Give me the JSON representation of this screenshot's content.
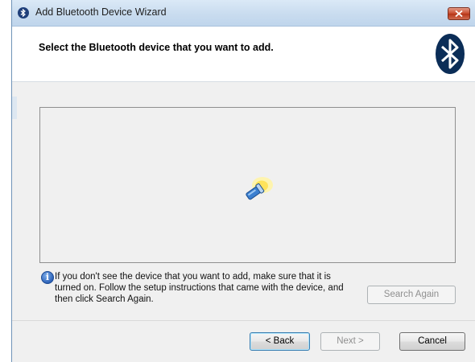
{
  "window": {
    "title": "Add Bluetooth Device Wizard"
  },
  "header": {
    "title": "Select the Bluetooth device that you want to add."
  },
  "device_list": {
    "state_icon": "searching-flashlight-icon"
  },
  "info": {
    "text": "If you don't see the device that you want to add, make sure that it is turned on. Follow the setup instructions that came with the device, and then click Search Again."
  },
  "buttons": {
    "search_again": "Search Again",
    "back": "< Back",
    "next": "Next >",
    "cancel": "Cancel"
  },
  "colors": {
    "bluetooth_badge": "#0b2d57",
    "close_button": "#c7492c",
    "info_icon": "#2d62b8"
  }
}
